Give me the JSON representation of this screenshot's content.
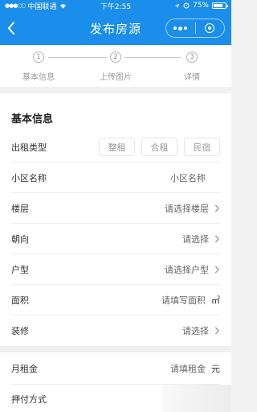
{
  "status_bar": {
    "carrier": "中国联通",
    "time": "下午2:55",
    "battery": "75%"
  },
  "navbar": {
    "title": "发布房源"
  },
  "steps": [
    {
      "number": "1",
      "label": "基本信息"
    },
    {
      "number": "2",
      "label": "上传图片"
    },
    {
      "number": "3",
      "label": "详情"
    }
  ],
  "basic_section": {
    "title": "基本信息",
    "rent_type": {
      "label": "出租类型",
      "options": [
        "整租",
        "合租",
        "民宿"
      ]
    },
    "community": {
      "label": "小区名称",
      "placeholder": "小区名称"
    },
    "floor": {
      "label": "楼层",
      "placeholder": "请选择楼层"
    },
    "orientation": {
      "label": "朝向",
      "placeholder": "请选择"
    },
    "layout": {
      "label": "户型",
      "placeholder": "请选择户型"
    },
    "area": {
      "label": "面积",
      "placeholder": "请填写面积",
      "unit": "㎡"
    },
    "decoration": {
      "label": "装修",
      "placeholder": "请选择"
    }
  },
  "price_section": {
    "rent": {
      "label": "月租金",
      "placeholder": "请填租金",
      "unit": "元"
    },
    "payment": {
      "label": "押付方式"
    }
  },
  "colors": {
    "accent": "#1a8eea",
    "background": "#f2f2f2"
  }
}
